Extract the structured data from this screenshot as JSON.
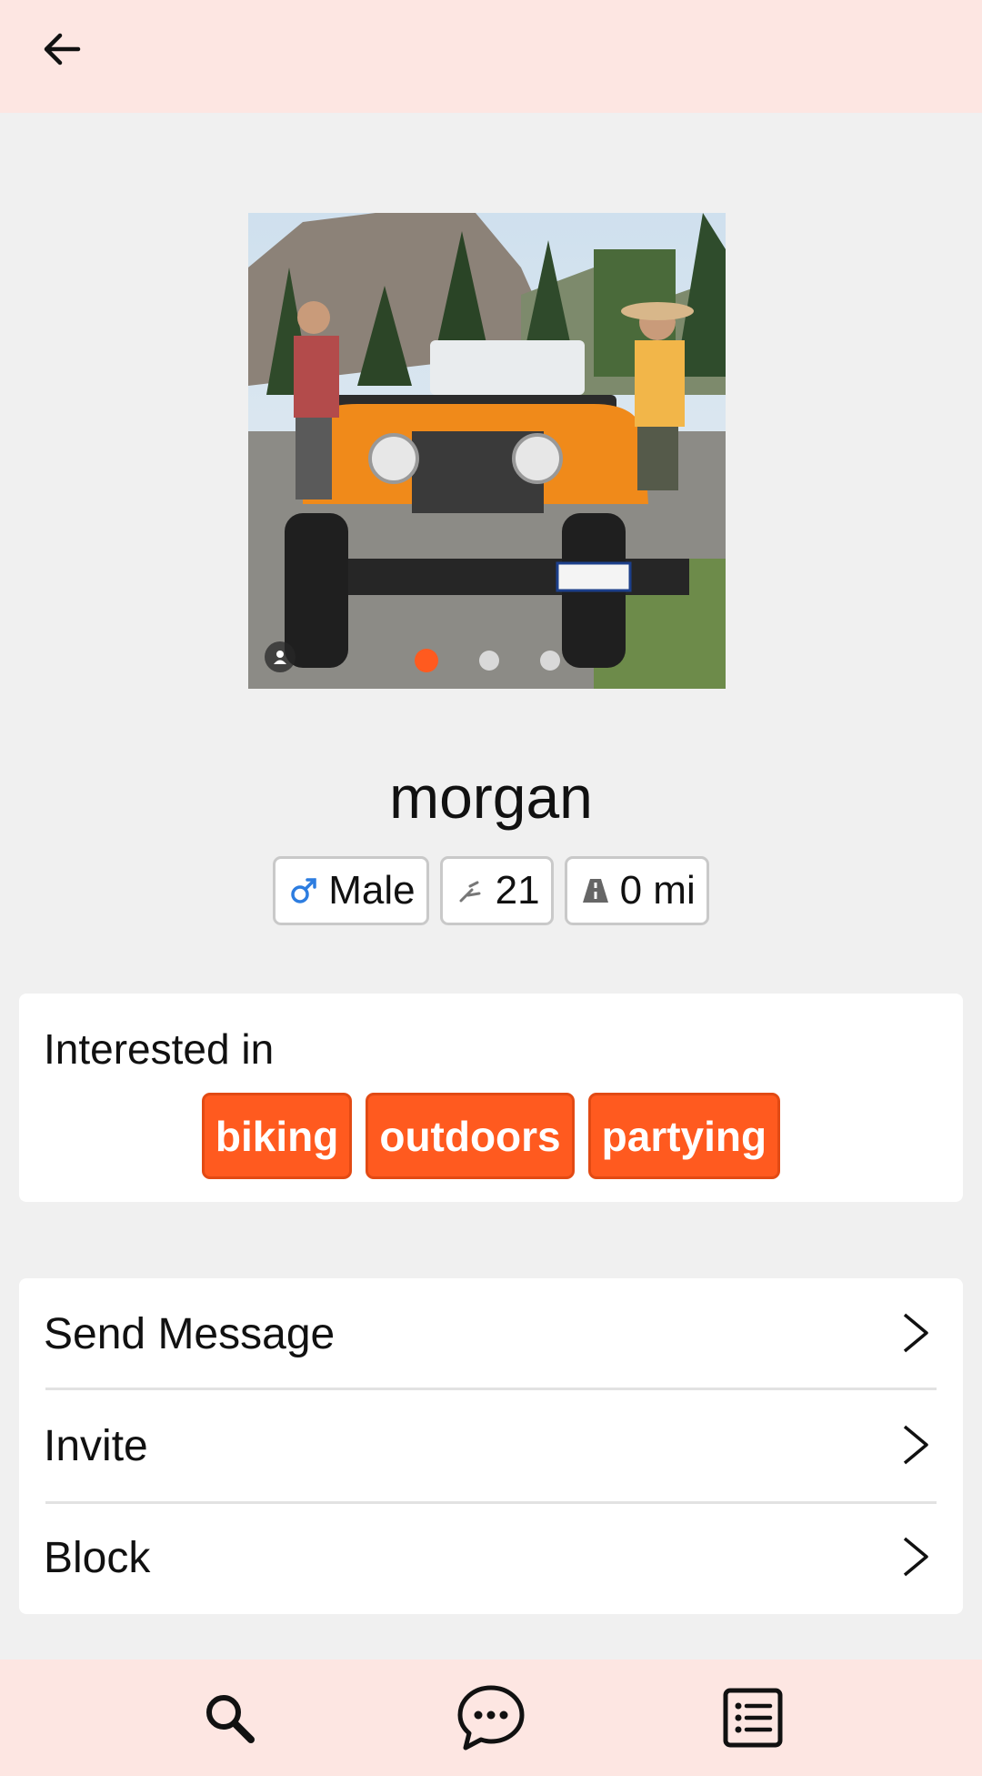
{
  "topbar": {
    "back_icon": "arrow-left-icon"
  },
  "profile": {
    "name": "morgan",
    "photo_count": 3,
    "photo_active_index": 0,
    "chips": {
      "gender": "Male",
      "age": "21",
      "distance": "0 mi"
    }
  },
  "interests": {
    "title": "Interested in",
    "tags": [
      "biking",
      "outdoors",
      "partying"
    ]
  },
  "actions": {
    "send_message": "Send Message",
    "invite": "Invite",
    "block": "Block"
  },
  "colors": {
    "accent": "#ff5a1f",
    "bar_background": "#fde6e2",
    "page_background": "#f0f0f0"
  },
  "bottom_nav": {
    "items": [
      "search-icon",
      "chat-bubble-icon",
      "list-icon"
    ]
  }
}
